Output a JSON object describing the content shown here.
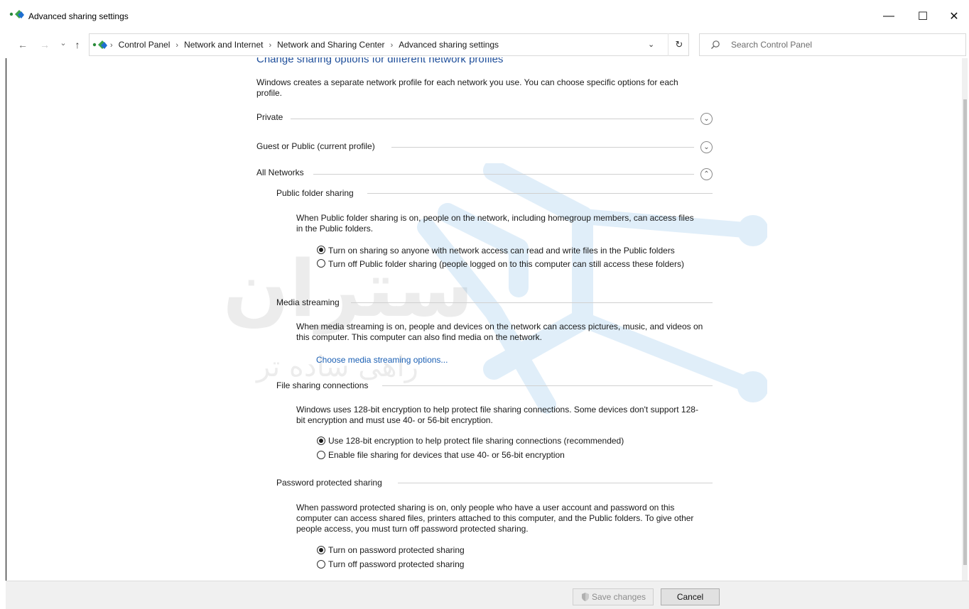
{
  "window": {
    "title": "Advanced sharing settings",
    "controls": {
      "minimize": "—",
      "maximize": "☐",
      "close": "✕"
    }
  },
  "navigation": {
    "back": "←",
    "forward": "→",
    "recent": "⌄",
    "up": "↑",
    "breadcrumb": [
      "Control Panel",
      "Network and Internet",
      "Network and Sharing Center",
      "Advanced sharing settings"
    ],
    "breadcrumb_separator": "›",
    "dropdown": "⌄",
    "refresh": "↻"
  },
  "search": {
    "placeholder": "Search Control Panel"
  },
  "page": {
    "heading": "Change sharing options for different network profiles",
    "intro": "Windows creates a separate network profile for each network you use. You can choose specific options for each profile."
  },
  "profiles": [
    {
      "label": "Private",
      "expanded": false
    },
    {
      "label": "Guest or Public (current profile)",
      "expanded": false
    },
    {
      "label": "All Networks",
      "expanded": true
    }
  ],
  "sections": {
    "public_folder": {
      "title": "Public folder sharing",
      "description": "When Public folder sharing is on, people on the network, including homegroup members, can access files in the Public folders.",
      "options": [
        {
          "label": "Turn on sharing so anyone with network access can read and write files in the Public folders",
          "checked": true
        },
        {
          "label": "Turn off Public folder sharing (people logged on to this computer can still access these folders)",
          "checked": false
        }
      ]
    },
    "media_streaming": {
      "title": "Media streaming",
      "description": "When media streaming is on, people and devices on the network can access pictures, music, and videos on this computer. This computer can also find media on the network.",
      "link": "Choose media streaming options..."
    },
    "file_sharing": {
      "title": "File sharing connections",
      "description": "Windows uses 128-bit encryption to help protect file sharing connections. Some devices don't support 128-bit encryption and must use 40- or 56-bit encryption.",
      "options": [
        {
          "label": "Use 128-bit encryption to help protect file sharing connections (recommended)",
          "checked": true
        },
        {
          "label": "Enable file sharing for devices that use 40- or 56-bit encryption",
          "checked": false
        }
      ]
    },
    "password_sharing": {
      "title": "Password protected sharing",
      "description": "When password protected sharing is on, only people who have a user account and password on this computer can access shared files, printers attached to this computer, and the Public folders. To give other people access, you must turn off password protected sharing.",
      "options": [
        {
          "label": "Turn on password protected sharing",
          "checked": true
        },
        {
          "label": "Turn off password protected sharing",
          "checked": false
        }
      ]
    }
  },
  "footer": {
    "save": "Save changes",
    "cancel": "Cancel"
  },
  "watermark": {
    "line1": "ستران",
    "line2": "راهی ساده تر"
  },
  "colors": {
    "heading": "#1e4e9a",
    "link": "#1a5fb4",
    "watermark": "#1a7fd4"
  }
}
